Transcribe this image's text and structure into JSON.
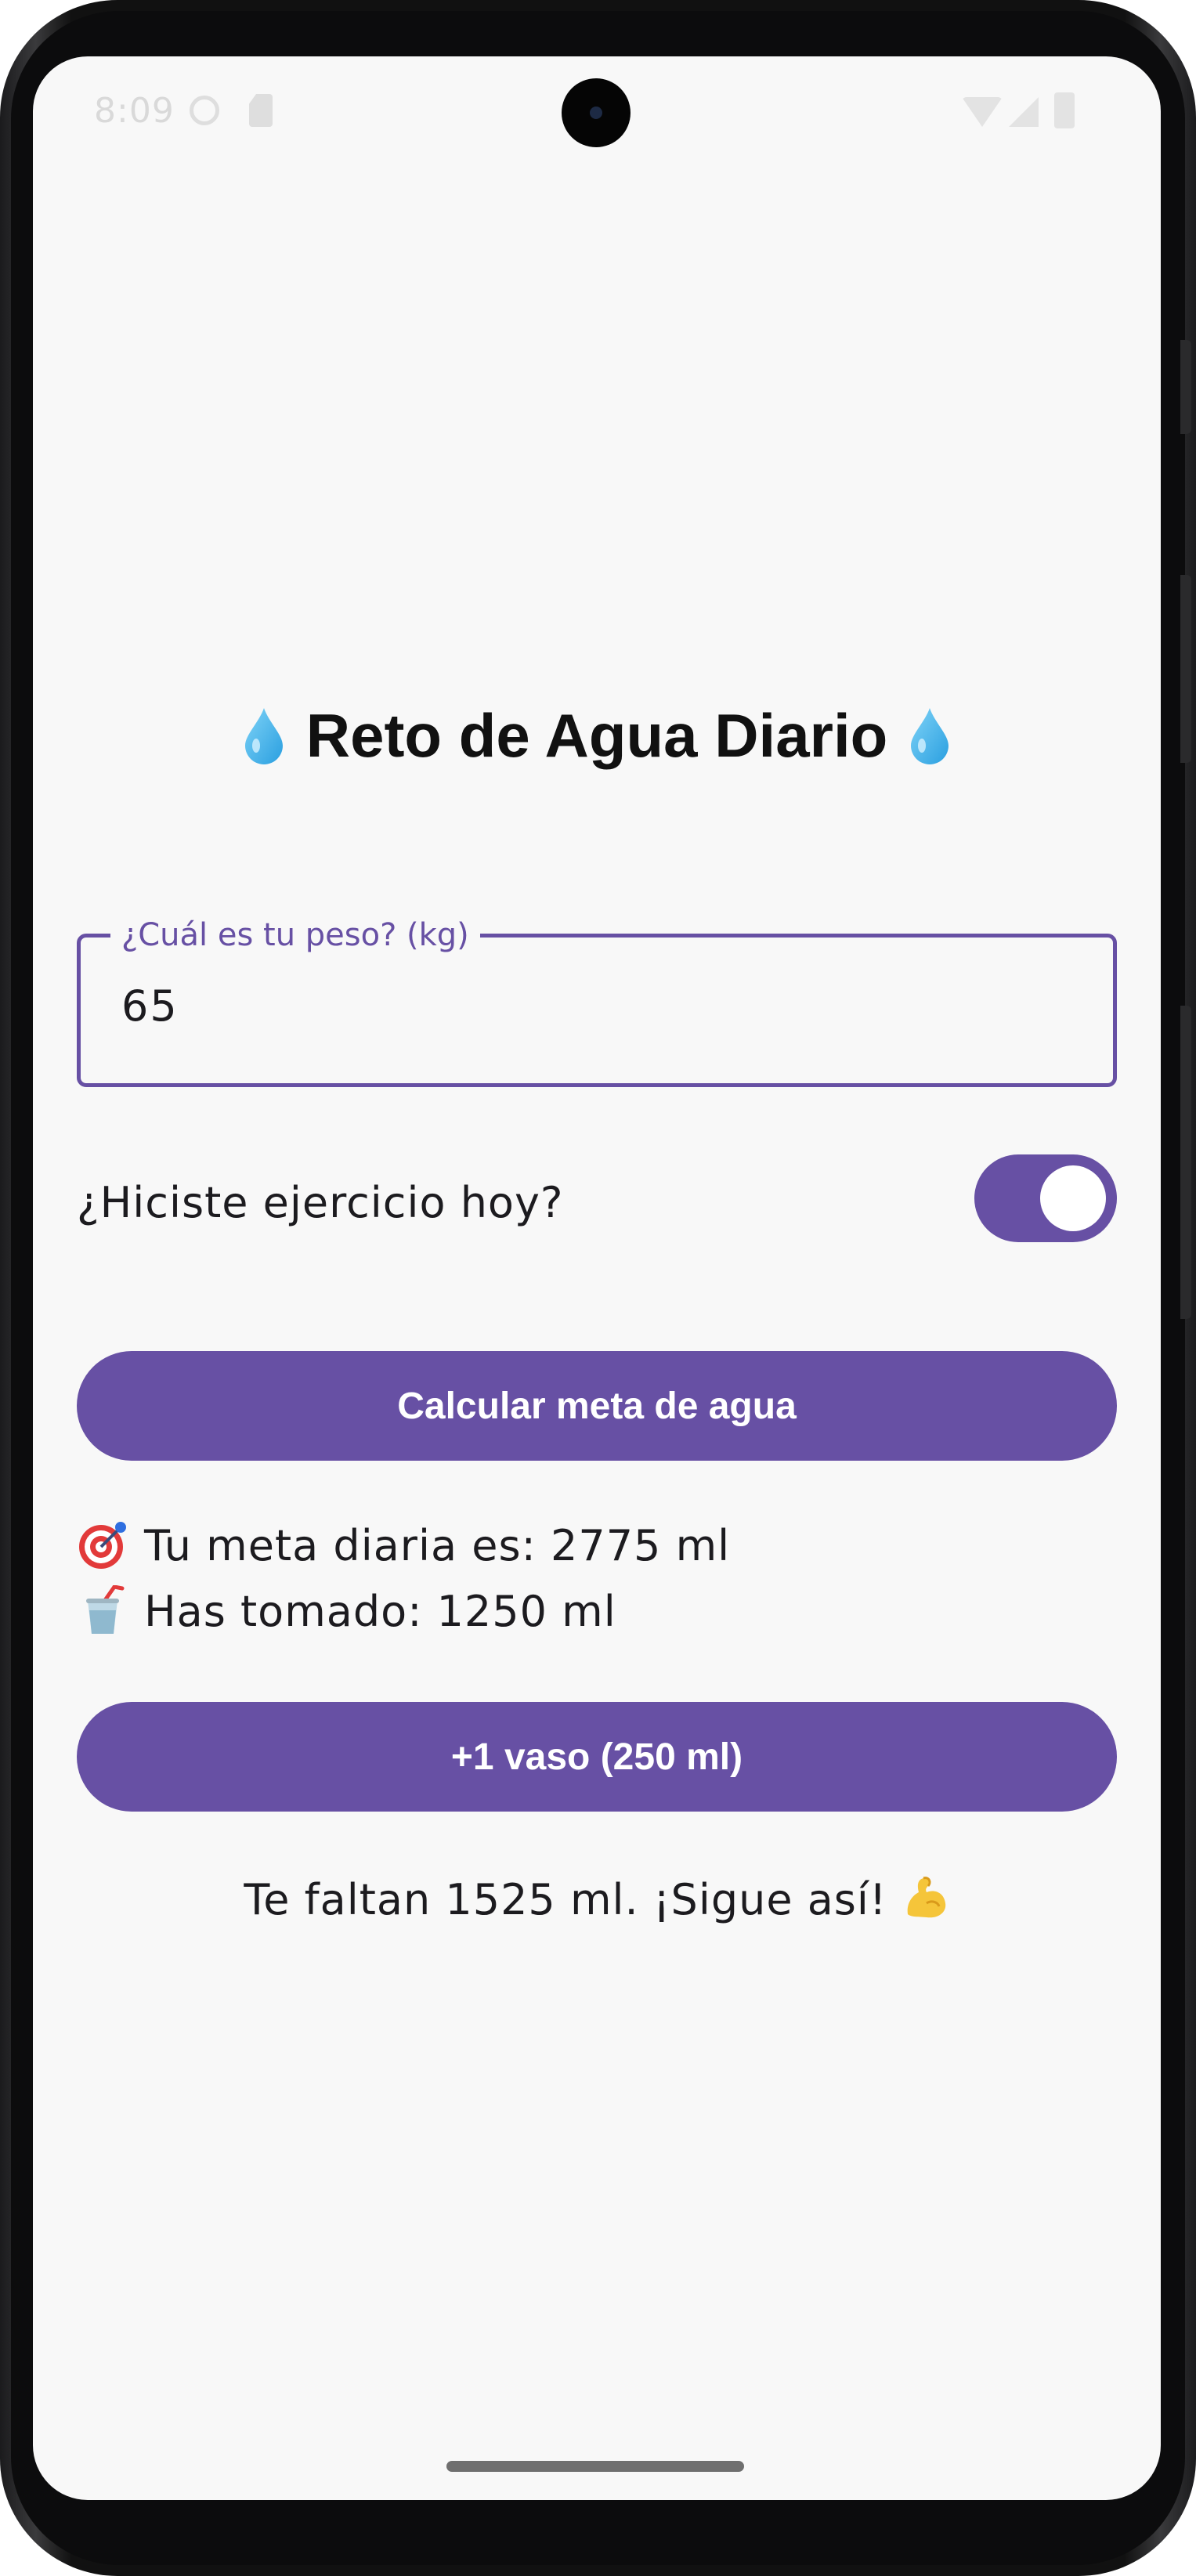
{
  "status_bar": {
    "time": "8:09",
    "icons": [
      "settings-gear-icon",
      "sim-card-icon",
      "wifi-icon",
      "signal-icon",
      "battery-icon"
    ]
  },
  "app": {
    "title": "Reto de Agua Diario",
    "title_icon": "water-drop-icon",
    "accent_color": "#6750a4",
    "background_color": "#f8f8f8"
  },
  "weight_field": {
    "label": "¿Cuál es tu peso? (kg)",
    "value": "65"
  },
  "exercise": {
    "label": "¿Hiciste ejercicio hoy?",
    "switch_on": true
  },
  "buttons": {
    "calculate_label": "Calcular meta de agua",
    "add_glass_label": "+1 vaso (250 ml)"
  },
  "results": {
    "goal_icon": "target-icon",
    "goal_text": "Tu meta diaria es: 2775 ml",
    "drunk_icon": "cup-with-straw-icon",
    "drunk_text": "Has tomado: 1250 ml",
    "remaining_text": "Te faltan 1525 ml. ¡Sigue así!",
    "remaining_icon": "flexed-biceps-icon"
  }
}
